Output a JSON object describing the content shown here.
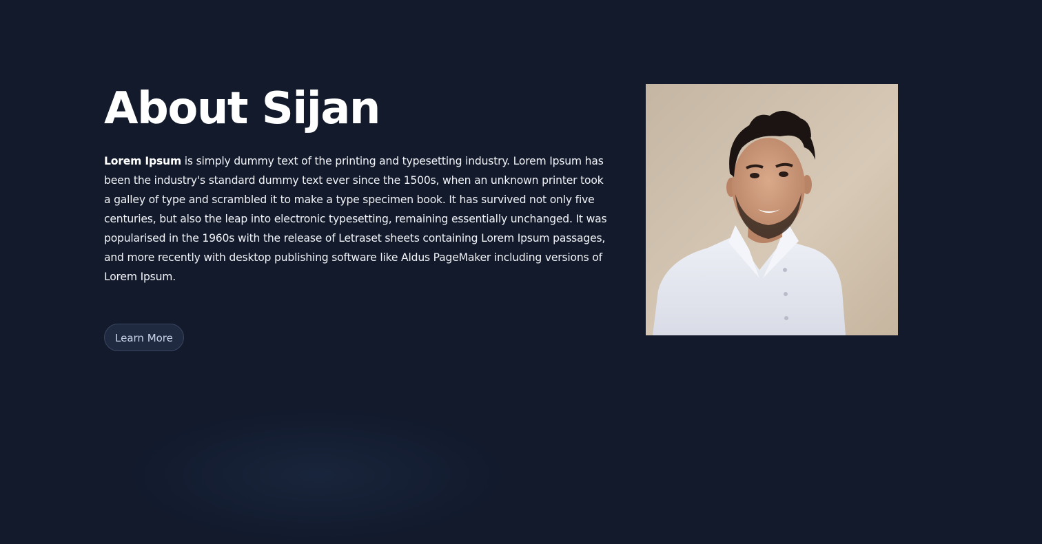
{
  "about": {
    "title": "About Sijan",
    "paragraph_bold": "Lorem Ipsum",
    "paragraph_rest": " is simply dummy text of the printing and typesetting industry. Lorem Ipsum has been the industry's standard dummy text ever since the 1500s, when an unknown printer took a galley of type and scrambled it to make a type specimen book. It has survived not only five centuries, but also the leap into electronic typesetting, remaining essentially unchanged. It was popularised in the 1960s with the release of Letraset sheets containing Lorem Ipsum passages, and more recently with desktop publishing software like Aldus PageMaker including versions of Lorem Ipsum.",
    "button_label": "Learn More"
  },
  "colors": {
    "background": "#121a2c",
    "button_background": "#1f2a40",
    "button_text": "#c9d4ea"
  }
}
